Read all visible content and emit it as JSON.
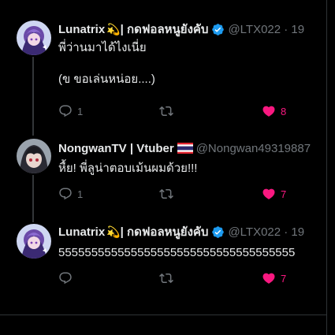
{
  "tweets": [
    {
      "display_name": "Lunatrix",
      "emoji": "💫",
      "name_suffix": " | กดฟอลหนูยังคับ",
      "handle": "@LTX022 · 19",
      "text": "พี่ว่านมาได้ไงเนี่ย\n\n(ข ขอเล่นหน่อย....)",
      "reply_count": "1",
      "like_count": "8",
      "liked": true
    },
    {
      "display_name": "NongwanTV | Vtuber",
      "handle": "@Nongwan49319887",
      "text": "หื้ย! พี่ลูน่าตอบเม้นผมด้วย!!!",
      "reply_count": "1",
      "like_count": "7",
      "liked": true
    },
    {
      "display_name": "Lunatrix",
      "emoji": "💫",
      "name_suffix": " | กดฟอลหนูยังคับ",
      "handle": "@LTX022 · 19",
      "text": "555555555555555555555555555555555555",
      "reply_count": "",
      "like_count": "7",
      "liked": true
    }
  ],
  "icons": {
    "reply": "reply-icon",
    "retweet": "retweet-icon",
    "like": "heart-icon",
    "verified": "verified-badge-icon",
    "flag": "thailand-flag-icon"
  },
  "colors": {
    "background": "#000000",
    "text": "#e7e9ea",
    "muted": "#71767b",
    "like": "#f91880",
    "verified": "#1d9bf0"
  }
}
